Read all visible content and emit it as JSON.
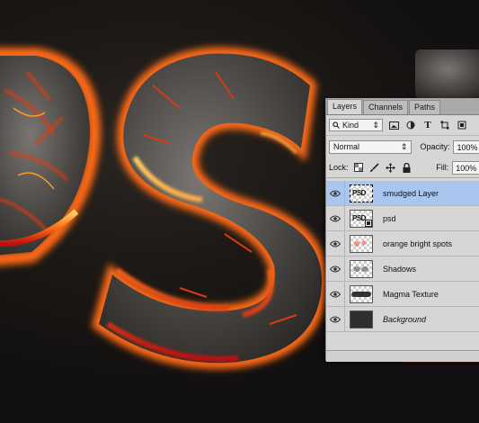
{
  "layers_panel": {
    "tabs": [
      "Layers",
      "Channels",
      "Paths"
    ],
    "active_tab": "Layers",
    "filter": {
      "kind_label": "Kind",
      "icons": [
        "search-icon",
        "image-filter-icon",
        "adjustment-filter-icon",
        "type-filter-icon",
        "shape-filter-icon",
        "smart-object-filter-icon"
      ]
    },
    "blend_mode": "Normal",
    "opacity_label": "Opacity:",
    "opacity_value": "100%",
    "lock_label": "Lock:",
    "lock_icons": [
      "lock-transparent-icon",
      "lock-paint-icon",
      "lock-position-icon",
      "lock-all-icon"
    ],
    "fill_label": "Fill:",
    "fill_value": "100%",
    "layers": [
      {
        "name": "smudged Layer",
        "thumb": "PSD",
        "selected": true,
        "visible": true
      },
      {
        "name": "psd",
        "thumb": "PSD",
        "selected": false,
        "visible": true
      },
      {
        "name": "orange bright spots",
        "thumb": "",
        "selected": false,
        "visible": true
      },
      {
        "name": "Shadows",
        "thumb": "",
        "selected": false,
        "visible": true
      },
      {
        "name": "Magma Texture",
        "thumb": "",
        "selected": false,
        "visible": true
      },
      {
        "name": "Background",
        "thumb": "",
        "selected": false,
        "visible": true
      }
    ]
  },
  "canvas": {
    "artwork_letters": "PS",
    "accent_colors": [
      "#ff5a10",
      "#ffb347",
      "#d81818"
    ]
  }
}
